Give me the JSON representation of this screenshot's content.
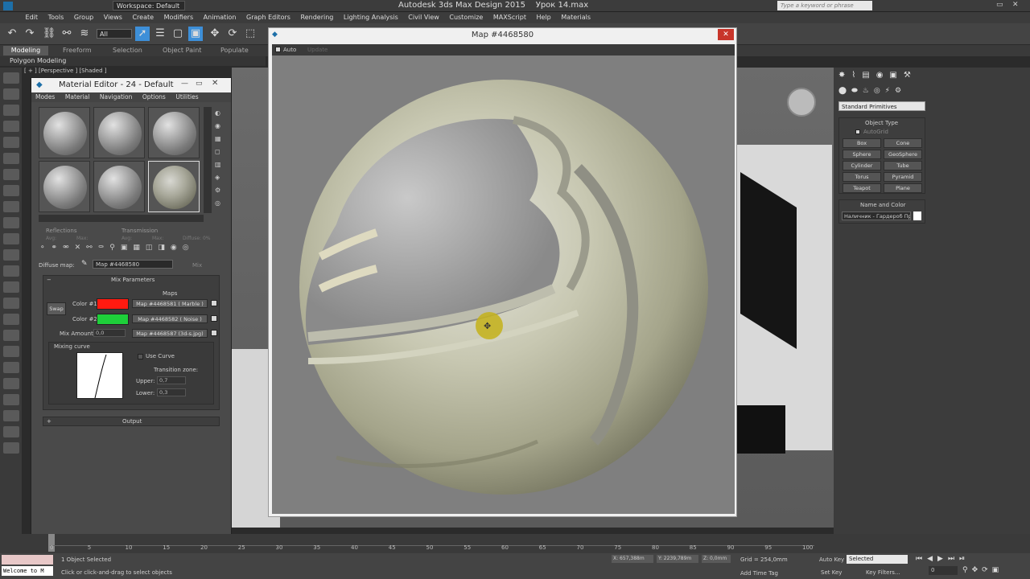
{
  "app": {
    "title": "Autodesk 3ds Max Design 2015",
    "file": "Урок 14.max",
    "workspace": "Workspace: Default",
    "search_placeholder": "Type a keyword or phrase"
  },
  "menu": [
    "Edit",
    "Tools",
    "Group",
    "Views",
    "Create",
    "Modifiers",
    "Animation",
    "Graph Editors",
    "Rendering",
    "Lighting Analysis",
    "Civil View",
    "Customize",
    "MAXScript",
    "Help",
    "Materials"
  ],
  "toolbar": {
    "selection_filter": "All"
  },
  "ribbon": {
    "tabs": [
      "Modeling",
      "Freeform",
      "Selection",
      "Object Paint",
      "Populate"
    ],
    "sub": "Polygon Modeling"
  },
  "viewport": {
    "label": "[ + ] [Perspective ] [Shaded ]"
  },
  "material_editor": {
    "title": "Material Editor - 24 - Default",
    "menu": [
      "Modes",
      "Material",
      "Navigation",
      "Options",
      "Utilities"
    ],
    "diffuse_label": "Diffuse map:",
    "diffuse_value": "Map #4468580",
    "mix_label": "Mix",
    "rollout_mix": "Mix Parameters",
    "maps_label": "Maps",
    "swap_label": "Swap",
    "color1_label": "Color #1",
    "color2_label": "Color #2",
    "mix_amount_label": "Mix Amount:",
    "mix_amount_value": "0,0",
    "map1": "Map #4468581  ( Marble )",
    "map2": "Map #4468582  ( Noise )",
    "map3": "Map #4468587 (3d-s.jpg)",
    "mixing_curve_label": "Mixing curve",
    "use_curve_label": "Use Curve",
    "transition_label": "Transition zone:",
    "upper_label": "Upper:",
    "upper_value": "0,7",
    "lower_label": "Lower:",
    "lower_value": "0,3",
    "output_label": "Output",
    "reflections_label": "Reflections",
    "transmission_label": "Transmission",
    "avg_label": "Avg:",
    "max_label": "Max:",
    "diffuse_pct": "Diffuse: 0%",
    "color1": "#ff1a10",
    "color2": "#1ecf3a"
  },
  "map_window": {
    "title": "Map #4468580",
    "auto_label": "Auto",
    "update_label": "Update"
  },
  "command_panel": {
    "dropdown": "Standard Primitives",
    "object_type": "Object Type",
    "autogrid": "AutoGrid",
    "buttons": [
      "Box",
      "Cone",
      "Sphere",
      "GeoSphere",
      "Cylinder",
      "Tube",
      "Torus",
      "Pyramid",
      "Teapot",
      "Plane"
    ],
    "name_color": "Name and Color",
    "name_value": "Наличник - Гардероб Пр"
  },
  "timeline": {
    "ticks": [
      "0",
      "5",
      "10",
      "15",
      "20",
      "25",
      "30",
      "35",
      "40",
      "45",
      "50",
      "55",
      "60",
      "65",
      "70",
      "75",
      "80",
      "85",
      "90",
      "95",
      "100"
    ],
    "counter": "0 / 100"
  },
  "status": {
    "selected": "1 Object Selected",
    "hint": "Click or click-and-drag to select objects",
    "maxscript": "Welcome to M",
    "x": "X: 657,388m",
    "y": "Y: 2239,789m",
    "z": "Z: 0,0mm",
    "grid": "Grid = 254,0mm",
    "auto_key": "Auto Key",
    "set_key": "Set Key",
    "selected_dropdown": "Selected",
    "key_filters": "Key Filters...",
    "add_time_tag": "Add Time Tag",
    "frame": "0"
  }
}
